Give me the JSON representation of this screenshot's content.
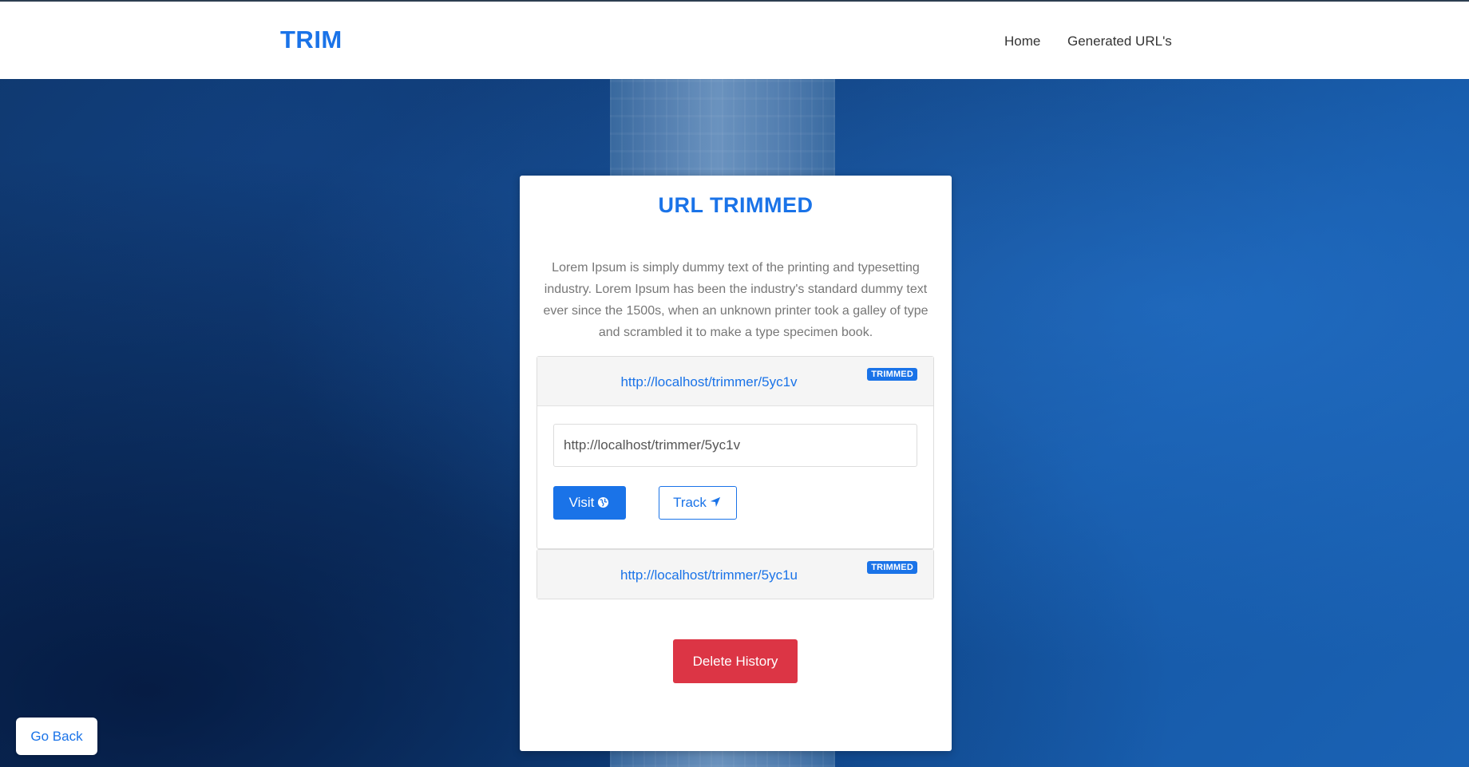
{
  "navbar": {
    "brand": "TRIM",
    "links": [
      "Home",
      "Generated URL's"
    ]
  },
  "card": {
    "title": "URL TRIMMED",
    "description": "Lorem Ipsum is simply dummy text of the printing and typesetting industry. Lorem Ipsum has been the industry's standard dummy text ever since the 1500s, when an unknown printer took a galley of type and scrambled it to make a type specimen book.",
    "entries": [
      {
        "url": "http://localhost/trimmer/5yc1v",
        "badge": "TRIMMED",
        "expanded": true,
        "input_value": "http://localhost/trimmer/5yc1v",
        "visit_label": "Visit",
        "visit_icon": "globe-icon",
        "track_label": "Track",
        "track_icon": "location-arrow-icon"
      },
      {
        "url": "http://localhost/trimmer/5yc1u",
        "badge": "TRIMMED",
        "expanded": false
      }
    ],
    "delete_label": "Delete History"
  },
  "go_back_label": "Go Back",
  "colors": {
    "primary": "#1a73e8",
    "danger": "#dc3545",
    "navbar_bg": "#ffffff"
  }
}
